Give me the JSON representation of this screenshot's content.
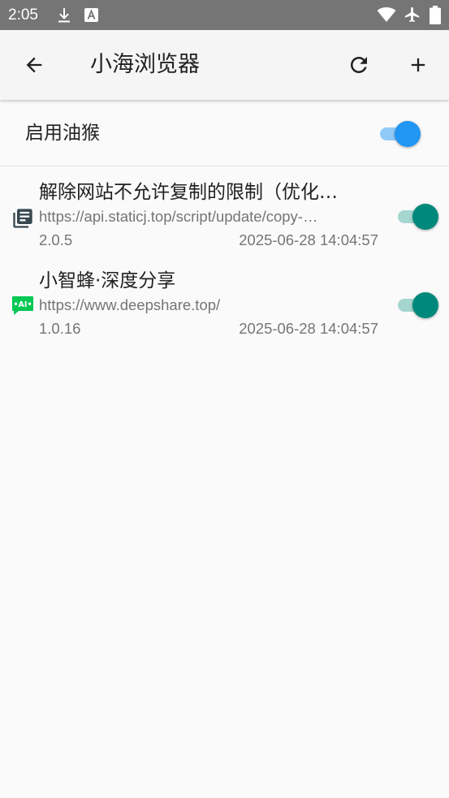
{
  "status_bar": {
    "time": "2:05",
    "icons": [
      "download-icon",
      "text-a-icon",
      "wifi-icon",
      "airplane-icon",
      "battery-icon"
    ]
  },
  "app_bar": {
    "title": "小海浏览器",
    "back_icon": "arrow-back-icon",
    "refresh_icon": "refresh-icon",
    "add_icon": "plus-icon"
  },
  "enable_setting": {
    "label": "启用油猴",
    "enabled": true,
    "accent_color": "#2196f3"
  },
  "scripts": [
    {
      "name": "解除网站不允许复制的限制（优化…",
      "url": "https://api.staticj.top/script/update/copy-…",
      "version": "2.0.5",
      "date": "2025-06-28 14:04:57",
      "icon": "document-icon",
      "enabled": true
    },
    {
      "name": "小智蜂·深度分享",
      "url": "https://www.deepshare.top/",
      "version": "1.0.16",
      "date": "2025-06-28 14:04:57",
      "icon": "ai-chat-icon",
      "enabled": true
    }
  ],
  "colors": {
    "status_bar": "#757575",
    "script_switch": "#00897b",
    "ai_icon": "#00c853",
    "doc_icon": "#37474f"
  }
}
